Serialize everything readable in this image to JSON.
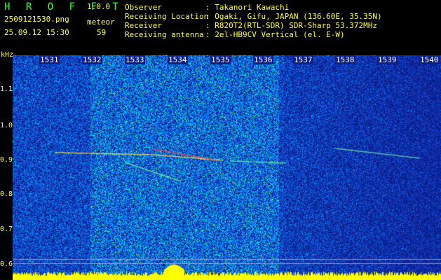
{
  "header": {
    "app_title": "HROFFT",
    "version": "1.0.0",
    "file_name": "2509121530.png",
    "event_label": "meteor",
    "date_time": "25.09.12 15:30",
    "event_count": "59"
  },
  "info": [
    {
      "key": "Observer",
      "value": ": Takanori Kawachi"
    },
    {
      "key": "Receiving Location",
      "value": ": Ogaki, Gifu, JAPAN (136.60E, 35.35N)"
    },
    {
      "key": "Receiver",
      "value": ": R820T2(RTL-SDR) SDR-Sharp 53.372MHz"
    },
    {
      "key": "Receiving antenna",
      "value": ": 2el-HB9CV Vertical (el. E-W)"
    }
  ],
  "chart_data": {
    "type": "heatmap",
    "ylabel": "kHz",
    "y_ticks": [
      "1.1",
      "1.0",
      "0.9",
      "0.8",
      "0.7",
      "0.6"
    ],
    "x_ticks": [
      "1531",
      "1532",
      "1533",
      "1534",
      "1535",
      "1536",
      "1537",
      "1538",
      "1539",
      "1540"
    ],
    "ylim": [
      0.58,
      1.19
    ],
    "colors": {
      "background": "#0a1e8c",
      "noise_low": "#1440d0",
      "noise_mid": "#00c8ff",
      "noise_high": "#40ff60",
      "peak": "#ffff00",
      "echo": "#ff4040"
    }
  }
}
